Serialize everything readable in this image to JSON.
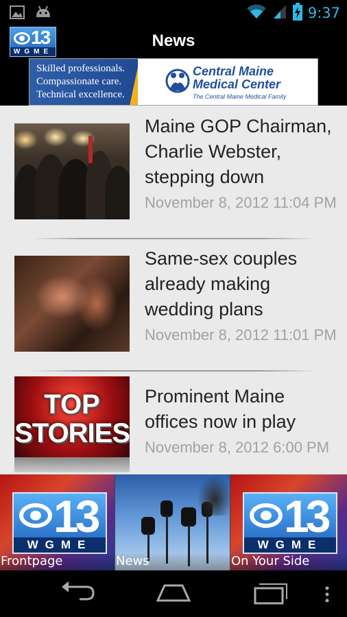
{
  "status_bar": {
    "time": "9:37",
    "icons": [
      "image-icon",
      "android-icon",
      "wifi-icon",
      "signal-icon",
      "battery-charging-icon"
    ]
  },
  "action_bar": {
    "title": "News",
    "logo": {
      "number": "13",
      "call_letters": "WGME"
    }
  },
  "ad": {
    "tagline_lines": [
      "Skilled professionals.",
      "Compassionate care.",
      "Technical excellence."
    ],
    "name_lines": [
      "Central Maine",
      "Medical Center"
    ],
    "subline": "The Central Maine Medical Family"
  },
  "news": {
    "items": [
      {
        "headline": "Maine GOP Chairman, Charlie Webster, stepping down",
        "timestamp": "November 8, 2012 11:04 PM"
      },
      {
        "headline": "Same-sex couples already making wedding plans",
        "timestamp": "November 8, 2012 11:01 PM"
      },
      {
        "headline": "Prominent Maine offices now in play",
        "timestamp": "November 8, 2012 6:00 PM"
      }
    ],
    "thumb3_text": [
      "TOP",
      "STORIES"
    ]
  },
  "tabs": [
    {
      "label": "Frontpage"
    },
    {
      "label": "News"
    },
    {
      "label": "On Your Side"
    }
  ],
  "tab_logo": {
    "number": "13",
    "call_letters": "WGME"
  },
  "colors": {
    "status_accent": "#33b5e5",
    "list_background": "#eaeaea",
    "timestamp_gray": "#a2a2a2",
    "ad_blue": "#1f4f9e"
  }
}
